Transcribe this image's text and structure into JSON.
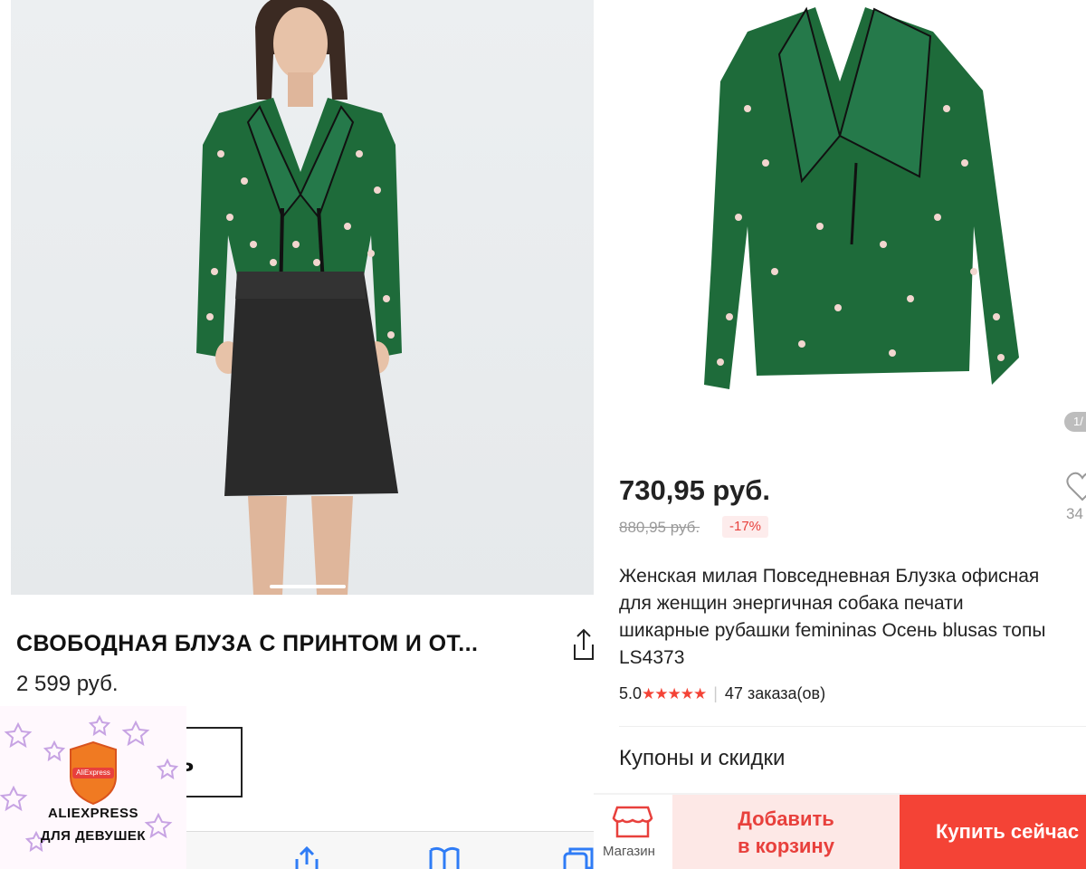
{
  "left": {
    "product_title": "СВОБОДНАЯ БЛУЗА С ПРИНТОМ И ОТ...",
    "price": "2 599 руб.",
    "add_button_partial": "ь",
    "icons": [
      "share-icon",
      "share-icon",
      "book-icon",
      "tabs-icon"
    ]
  },
  "sticker": {
    "logo_text": "AliExpress",
    "line1": "ALIEXPRESS",
    "line2": "ДЛЯ ДЕВУШЕК"
  },
  "right": {
    "image_counter": "1/",
    "price": "730,95 руб.",
    "old_price": "880,95 руб.",
    "discount": "-17%",
    "wishlist_count": "34",
    "description_lines": [
      "Женская милая Повседневная Блузка офисная",
      "для женщин энергичная собака печати",
      "шикарные рубашки femininas Осень blusas топы",
      "LS4373"
    ],
    "rating": "5.0",
    "stars": "★★★★★",
    "orders": "47 заказа(ов)",
    "coupons_label": "Купоны и скидки",
    "store_label": "Магазин",
    "add_to_cart_line1": "Добавить",
    "add_to_cart_line2": "в корзину",
    "buy_now": "Купить сейчас"
  },
  "colors": {
    "ali_red": "#f44336",
    "ali_cart_bg": "#fde8e6",
    "blouse_green": "#1e6b3a",
    "skirt_black": "#2a2a2a"
  }
}
